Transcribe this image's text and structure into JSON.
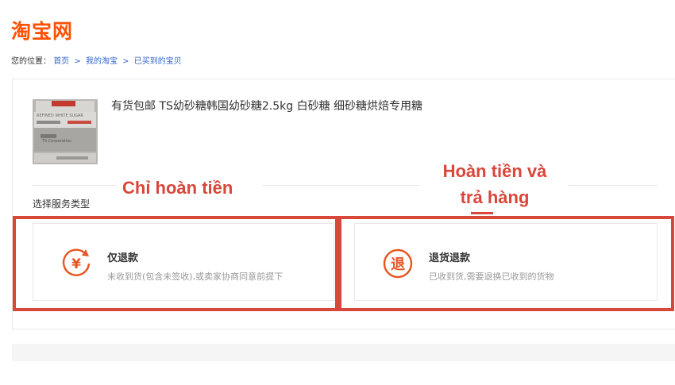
{
  "header": {
    "logo_text": "淘宝网"
  },
  "breadcrumb": {
    "prefix": "您的位置：",
    "items": [
      "首页",
      "我的淘宝",
      "已买到的宝贝"
    ],
    "separator": ">"
  },
  "product": {
    "title": "有货包邮 TS幼砂糖韩国幼砂糖2.5kg 白砂糖 细砂糖烘焙专用糖",
    "thumbnail_text": {
      "line1": "REFINED WHITE SUGAR",
      "line2": "TS Corporation"
    }
  },
  "service": {
    "section_label": "选择服务类型",
    "options": [
      {
        "icon": "yen-refund-icon",
        "glyph": "¥",
        "title": "仅退款",
        "desc": "未收到货(包含未签收),或卖家协商同意前提下"
      },
      {
        "icon": "return-refund-icon",
        "glyph": "退",
        "title": "退货退款",
        "desc": "已收到货,需要退换已收到的货物"
      }
    ]
  },
  "annotations": {
    "left": "Chỉ hoàn tiền",
    "right_line1": "Hoàn tiền và",
    "right_line2": "trả hàng"
  },
  "colors": {
    "brand": "#ff5000",
    "annotation": "#d9463a",
    "link": "#3366cc",
    "icon": "#e8551f"
  }
}
